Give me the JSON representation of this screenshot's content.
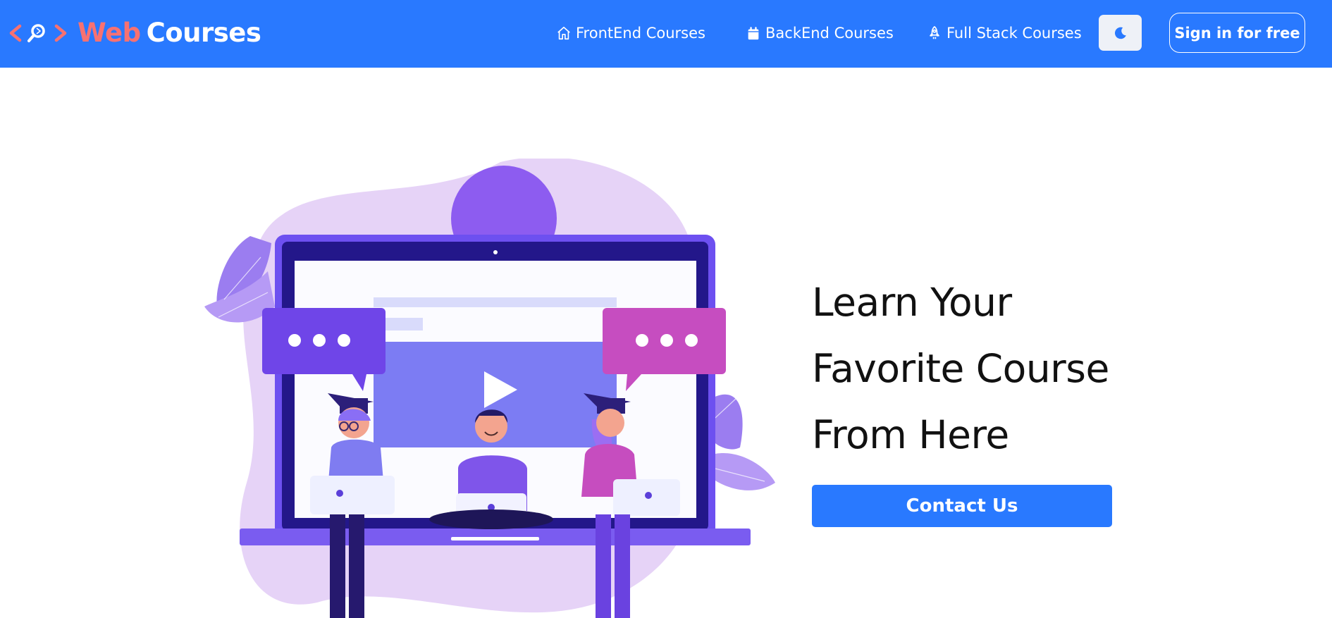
{
  "brand": {
    "name_part1": "Web",
    "name_part2": "Courses",
    "icon": "code-search-logo-icon",
    "color_primary": "#f87171",
    "color_secondary": "#ffffff"
  },
  "nav": {
    "background": "#2979ff",
    "links": [
      {
        "label": "FrontEnd Courses",
        "icon": "home-icon"
      },
      {
        "label": "BackEnd Courses",
        "icon": "calendar-icon"
      },
      {
        "label": "Full Stack Courses",
        "icon": "rocket-icon"
      }
    ],
    "theme_toggle_icon": "moon-icon",
    "signin_label": "Sign in for free"
  },
  "hero": {
    "title_lines": [
      "Learn Your",
      "Favorite Course",
      "From Here"
    ],
    "cta_label": "Contact Us",
    "illustration": "online-course-students-laptop-illustration"
  }
}
